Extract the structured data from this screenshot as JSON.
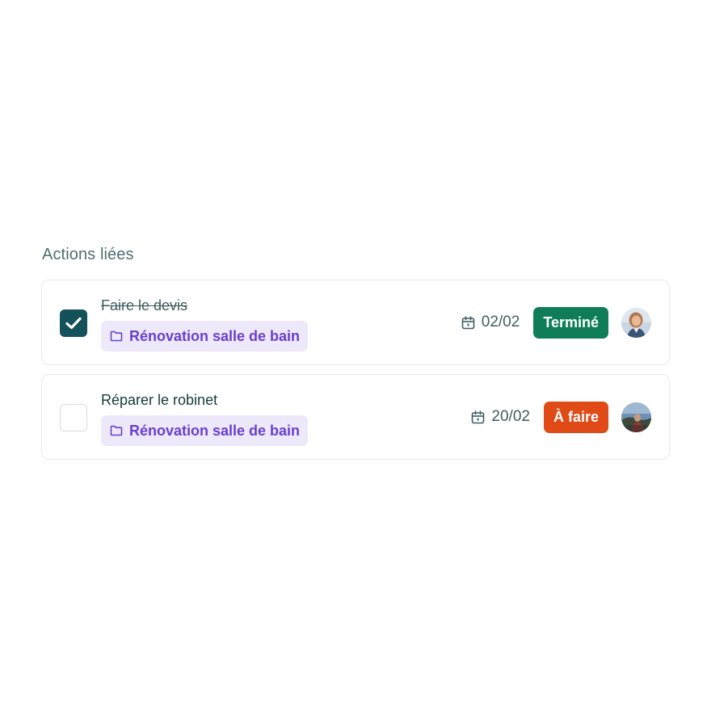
{
  "section": {
    "title": "Actions liées"
  },
  "colors": {
    "checkbox_checked": "#14515a",
    "tag_bg": "#ede9fb",
    "tag_text": "#6a3fd0",
    "status_done": "#0f7d58",
    "status_todo": "#df4a16"
  },
  "tasks": [
    {
      "title": "Faire le devis",
      "done": true,
      "project": "Rénovation salle de bain",
      "project_icon": "folder-icon",
      "due_date": "02/02",
      "due_icon": "calendar-icon",
      "status": "Terminé",
      "status_color": "#0f7d58",
      "assignee_avatar": "user-avatar"
    },
    {
      "title": "Réparer le robinet",
      "done": false,
      "project": "Rénovation salle de bain",
      "project_icon": "folder-icon",
      "due_date": "20/02",
      "due_icon": "calendar-icon",
      "status": "À faire",
      "status_color": "#df4a16",
      "assignee_avatar": "user-avatar"
    }
  ]
}
